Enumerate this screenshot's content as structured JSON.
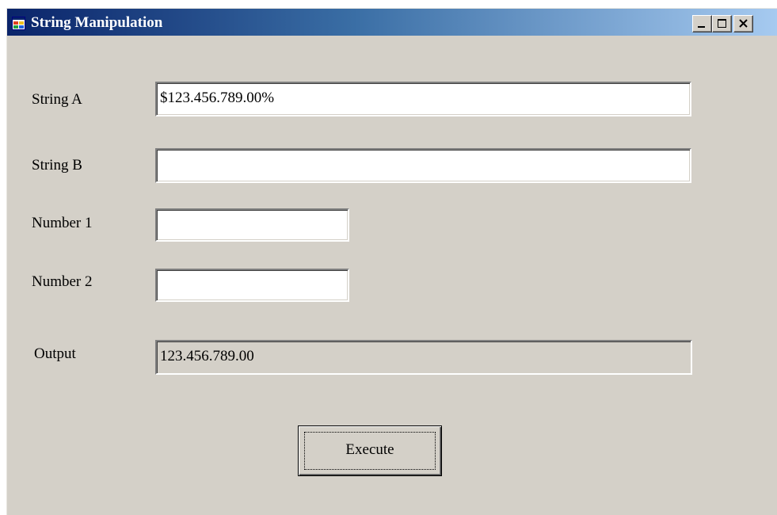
{
  "window": {
    "title": "String Manipulation",
    "icon": "app-window-icon",
    "controls": [
      "minimize-icon",
      "maximize-icon",
      "close-icon"
    ]
  },
  "form": {
    "string_a": {
      "label": "String A",
      "value": "$123.456.789.00%"
    },
    "string_b": {
      "label": "String B",
      "value": ""
    },
    "number_1": {
      "label": "Number 1",
      "value": ""
    },
    "number_2": {
      "label": "Number 2",
      "value": ""
    },
    "output": {
      "label": "Output",
      "value": "123.456.789.00"
    }
  },
  "execute_label": "Execute",
  "colors": {
    "titlebar_start": "#0a246a",
    "titlebar_end": "#a6caf0",
    "window_face": "#d4d0c8"
  }
}
